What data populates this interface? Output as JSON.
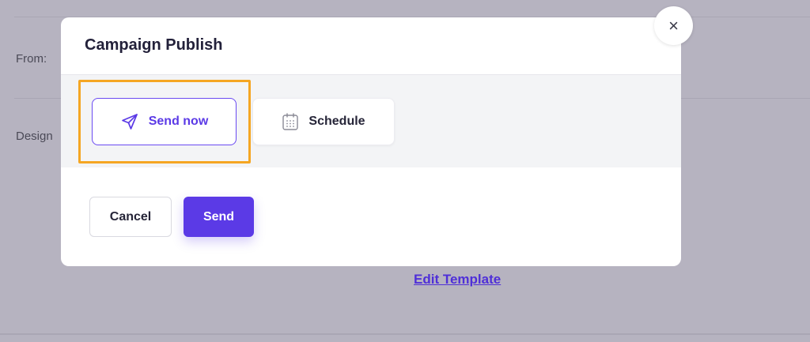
{
  "background": {
    "from_label": "From:",
    "design_label": "Design",
    "edit_template_link": "Edit Template"
  },
  "modal": {
    "title": "Campaign Publish",
    "options": {
      "send_now": {
        "label": "Send now",
        "icon": "paper-plane-icon",
        "selected": true
      },
      "schedule": {
        "label": "Schedule",
        "icon": "calendar-icon",
        "selected": false
      }
    },
    "footer": {
      "cancel_label": "Cancel",
      "send_label": "Send"
    },
    "close_label": "×"
  },
  "colors": {
    "accent": "#5b3ae6",
    "highlight": "#f5a623",
    "overlay": "#b6b3c0"
  }
}
